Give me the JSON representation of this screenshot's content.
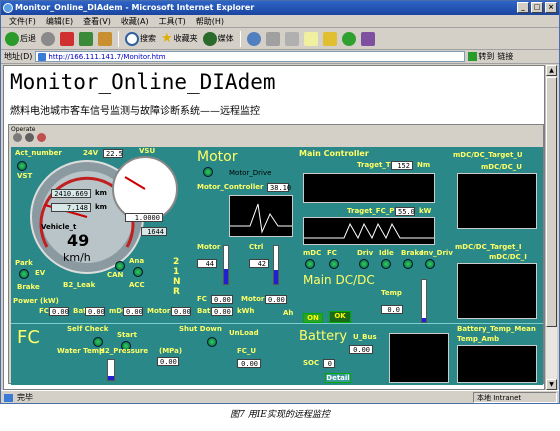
{
  "window": {
    "title": "Monitor_Online_DIAdem - Microsoft Internet Explorer"
  },
  "menu": [
    "文件(F)",
    "编辑(E)",
    "查看(V)",
    "收藏(A)",
    "工具(T)",
    "帮助(H)"
  ],
  "toolbar": {
    "back": "后退",
    "search": "搜索",
    "favorites": "收藏夹",
    "media": "媒体"
  },
  "address": {
    "label": "地址(D)",
    "url": "http://166.111.141.7/Monitor.htm",
    "go": "转到",
    "links": "链接"
  },
  "page": {
    "title": "Monitor_Online_DIAdem",
    "subtitle": "燃料电池城市客车信号监测与故障诊断系统——远程监控",
    "operate": "Operate"
  },
  "panel": {
    "act_number": "Act_number",
    "v24": "24V",
    "v24_val": "22.5",
    "vsu": "VSU",
    "vst": "VST",
    "odometer": "2410.669",
    "km1": "km",
    "trip": "7.148",
    "km2": "km",
    "vehicle": "Vehicle_t",
    "speed": "49",
    "speed_unit": "km/h",
    "tach_val": "1.0000",
    "count": "1644",
    "park": "Park",
    "brake": "Brake",
    "ev": "EV",
    "b2_leak": "B2_Leak",
    "can": "CAN",
    "ana": "Ana",
    "acc": "ACC",
    "gear1": "2",
    "gear2": "1",
    "gear3": "N",
    "gear4": "R",
    "motor": "Motor",
    "motor_drive": "Motor_Drive",
    "motor_controller": "Motor_Controller",
    "mc_val": "38.10",
    "motor_lbl": "Motor",
    "motor_val": "44",
    "ctrl": "Ctrl",
    "ctrl_val": "42",
    "main_controller": "Main  Controller",
    "traget_t": "Traget_T",
    "traget_val": "152",
    "nm": "Nm",
    "traget_fc": "Traget_FC_P",
    "fc_val": "55.0",
    "kw": "kW",
    "mdc": "mDC",
    "fc": "FC",
    "driv": "Driv",
    "idle": "Idle",
    "brake2": "Brake",
    "inv_driv": "Inv_Driv",
    "mdc_target_u": "mDC/DC_Target_U",
    "mdc_u": "mDC/DC_U",
    "mdc_target_i": "mDC/DC_Target_I",
    "mdc_i": "mDC/DC_I",
    "main_dcdc": "Main DC/DC",
    "temp": "Temp",
    "temp_val": "0.0",
    "on": "ON",
    "ok": "OK",
    "power": "Power (kW)",
    "fc_l": "FC",
    "fc_p": "0.00",
    "bat": "Bat",
    "bat_p": "0.00",
    "mdc2": "mDC",
    "mdc_p": "0.00",
    "motor_p_l": "Motor",
    "motor_p": "0.00",
    "fc2": "FC",
    "bat2": "Bat",
    "fc_kwh": "0.00",
    "bat_kwh": "0.00",
    "kwh": "kWh",
    "motor3": "Motor",
    "motor_ah": "0.00",
    "ah": "Ah",
    "fc_big": "FC",
    "self_check": "Self Check",
    "start": "Start",
    "shut_down": "Shut Down",
    "unload": "UnLoad",
    "water_temp": "Water Temp",
    "h2_pressure": "H2_Pressure",
    "mpa": "(MPa)",
    "h2_val": "0.00",
    "fc_u": "FC_U",
    "fc_u_val": "0.00",
    "battery": "Battery",
    "u_bus": "U_Bus",
    "u_bus_val": "0.00",
    "soc": "SOC",
    "soc_val": "0",
    "detail": "Detail",
    "battery_temp_mean": "Battery_Temp_Mean",
    "temp_amb": "Temp_Amb"
  },
  "status": {
    "left": "完毕",
    "right": "本地 Intranet"
  },
  "caption": "图7 用IE实现的远程监控",
  "colors": {
    "panel": "#2a8888",
    "label": "#ffff66",
    "titlebar": "#2f64c8"
  }
}
